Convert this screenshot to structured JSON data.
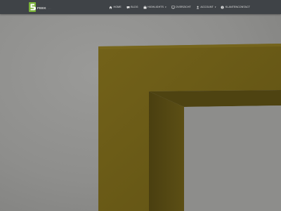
{
  "logo": {
    "mark_text": "5",
    "name": "FEEK",
    "tagline": "......"
  },
  "nav": {
    "items": [
      {
        "id": "home",
        "label": "HOME",
        "icon": "home-icon"
      },
      {
        "id": "blog",
        "label": "BLOG",
        "icon": "chat-icon"
      },
      {
        "id": "highlights",
        "label": "HIGHLIGHTS",
        "icon": "briefcase-icon",
        "dropdown": true
      },
      {
        "id": "overview",
        "label": "OVERZICHT",
        "icon": "monitor-icon"
      },
      {
        "id": "account",
        "label": "ACCOUNT",
        "icon": "user-icon",
        "dropdown": true
      },
      {
        "id": "customer-contact",
        "label": "KLANTENCONTACT",
        "icon": "info-icon"
      }
    ]
  },
  "colors": {
    "navbar": "#3f4347",
    "logo_green": "#7bb33a",
    "sign_gold": "#6a5a17",
    "background_gray": "#8f8f8d"
  }
}
